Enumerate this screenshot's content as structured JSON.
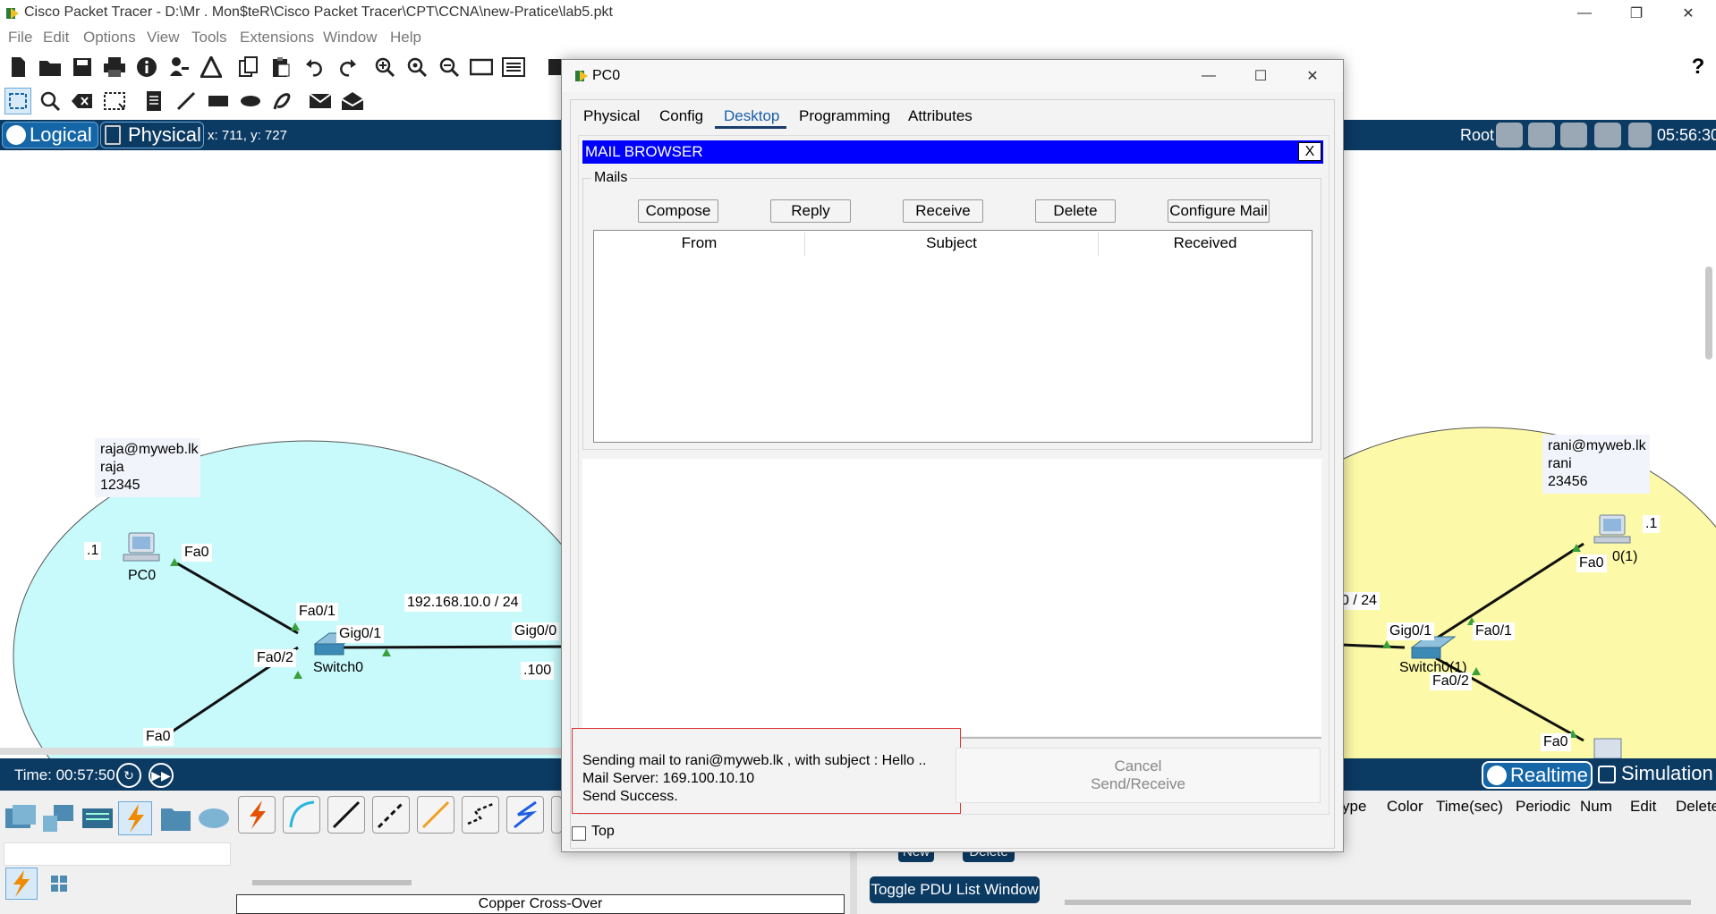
{
  "window": {
    "title": "Cisco Packet Tracer - D:\\Mr . Mon$teR\\Cisco Packet Tracer\\CPT\\CCNA\\new-Pratice\\lab5.pkt"
  },
  "menu": [
    "File",
    "Edit",
    "Options",
    "View",
    "Tools",
    "Extensions",
    "Window",
    "Help"
  ],
  "toolbar": {
    "help_label": "?"
  },
  "workspace_bar": {
    "logical_label": "Logical",
    "physical_label": "Physical",
    "coords": "x: 711, y: 727",
    "root_label": "Root",
    "clock": "05:56:30"
  },
  "topology": {
    "left_note": {
      "line1": "raja@myweb.lk",
      "line2": "raja",
      "line3": "12345"
    },
    "right_note": {
      "line1": "rani@myweb.lk",
      "line2": "rani",
      "line3": "23456"
    },
    "labels": {
      "left_pc_ip": ".1",
      "left_pc_if": "Fa0",
      "left_pc_name": "PC0",
      "switch0_fa01": "Fa0/1",
      "switch0_gig01": "Gig0/1",
      "switch0_fa02": "Fa0/2",
      "switch0_name": "Switch0",
      "network": "192.168.10.0 / 24",
      "router_gig00": "Gig0/0",
      "router_ip": ".100",
      "left_bottom_fa0": "Fa0",
      "right_network": "0 / 24",
      "right_gig01": "Gig0/1",
      "right_fa01": "Fa0/1",
      "right_switch_name": "Switch0(1)",
      "right_fa02": "Fa0/2",
      "right_pc_ip": ".1",
      "right_pc_if": "Fa0",
      "right_pc_name": "0(1)",
      "right_bottom_fa0": "Fa0"
    }
  },
  "timebar": {
    "time": "Time: 00:57:50",
    "realtime_label": "Realtime",
    "simulation_label": "Simulation"
  },
  "bottom_panel": {
    "connection_name": "Copper Cross-Over",
    "pdu_buttons": {
      "new": "New",
      "delete": "Delete",
      "toggle": "Toggle PDU List Window"
    },
    "pdu_columns": [
      "ype",
      "Color",
      "Time(sec)",
      "Periodic",
      "Num",
      "Edit",
      "Delete"
    ]
  },
  "dialog": {
    "title": "PC0",
    "tabs": [
      "Physical",
      "Config",
      "Desktop",
      "Programming",
      "Attributes"
    ],
    "active_tab": "Desktop",
    "mail_browser": {
      "header": "MAIL BROWSER",
      "close_label": "X",
      "group_label": "Mails",
      "buttons": [
        "Compose",
        "Reply",
        "Receive",
        "Delete",
        "Configure Mail"
      ],
      "columns": [
        "From",
        "Subject",
        "Received"
      ],
      "status": {
        "line1": "Sending mail to rani@myweb.lk , with subject : Hello ..",
        "line2": "Mail Server: 169.100.10.10",
        "line3": "Send Success."
      },
      "cancel_line1": "Cancel",
      "cancel_line2": "Send/Receive"
    },
    "top_checkbox_label": "Top"
  },
  "colors": {
    "accent": "#0b3a63",
    "mail_header": "#0000ff",
    "left_area": "#c8fafc",
    "right_area": "#fcf9a8",
    "status_border": "#dd3333"
  }
}
